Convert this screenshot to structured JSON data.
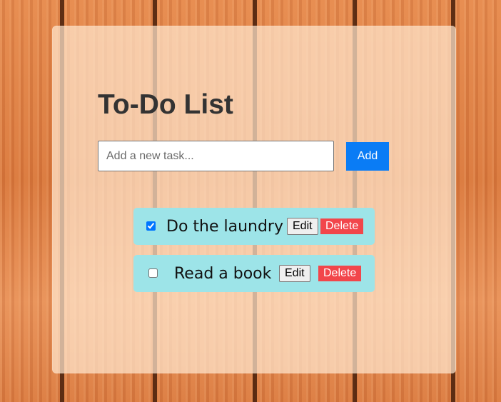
{
  "app": {
    "title": "To-Do List"
  },
  "new_task": {
    "placeholder": "Add a new task...",
    "value": "",
    "add_label": "Add"
  },
  "tasks": [
    {
      "text": "Do the laundry",
      "completed": true,
      "edit_label": "Edit",
      "delete_label": "Delete"
    },
    {
      "text": "Read a book",
      "completed": false,
      "edit_label": "Edit",
      "delete_label": "Delete"
    }
  ],
  "colors": {
    "card_background": "#ffe6cd",
    "title_text": "#333333",
    "add_button": "#0a7cf5",
    "task_row": "#9de4e8",
    "delete_button": "#f2464b",
    "edit_button": "#efefef"
  }
}
